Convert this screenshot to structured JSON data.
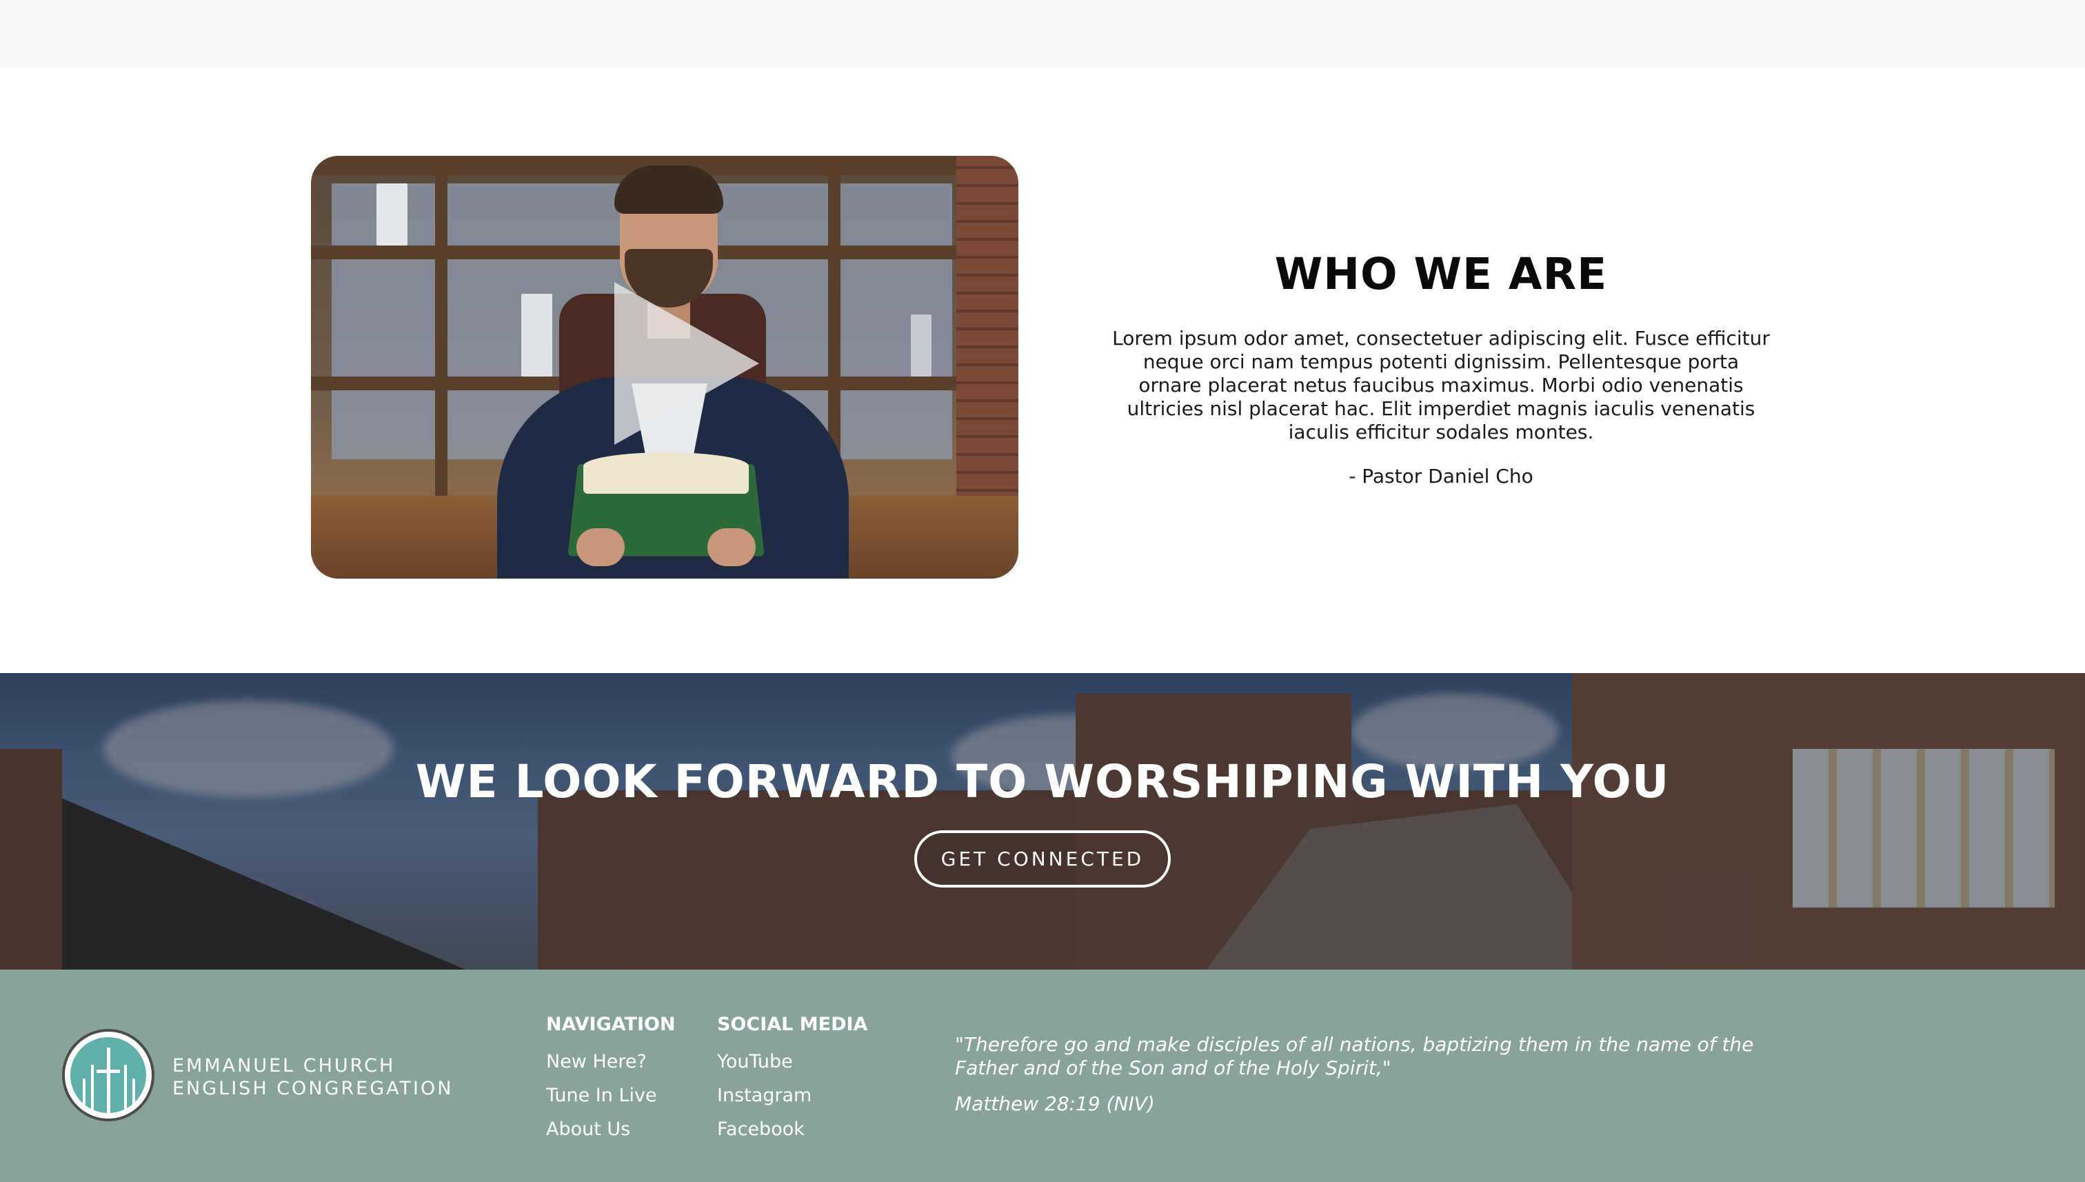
{
  "about": {
    "title": "WHO WE ARE",
    "body": "Lorem ipsum odor amet, consectetuer adipiscing elit. Fusce efficitur neque orci nam tempus potenti dignissim. Pellentesque porta ornare placerat netus faucibus maximus. Morbi odio venenatis ultricies nisl placerat hac. Elit imperdiet magnis iaculis venenatis iaculis efficitur sodales montes.",
    "signature": "- Pastor Daniel Cho",
    "video_icon": "play-icon"
  },
  "banner": {
    "title": "WE LOOK FORWARD TO WORSHIPING WITH YOU",
    "button_label": "GET CONNECTED"
  },
  "footer": {
    "logo_icon": "cross-logo-icon",
    "church_name_line1": "EMMANUEL CHURCH",
    "church_name_line2": "ENGLISH CONGREGATION",
    "navigation": {
      "heading": "NAVIGATION",
      "links": [
        "New Here?",
        "Tune In Live",
        "About Us"
      ]
    },
    "social": {
      "heading": "SOCIAL MEDIA",
      "links": [
        "YouTube",
        "Instagram",
        "Facebook"
      ]
    },
    "quote": "\"Therefore go and make disciples of all nations, baptizing them in the name of the Father and of the Son and of the Holy Spirit,\"",
    "quote_ref": "Matthew 28:19 (NIV)"
  },
  "colors": {
    "footer_bg": "#87a39b",
    "logo_teal": "#5fb0aa"
  }
}
